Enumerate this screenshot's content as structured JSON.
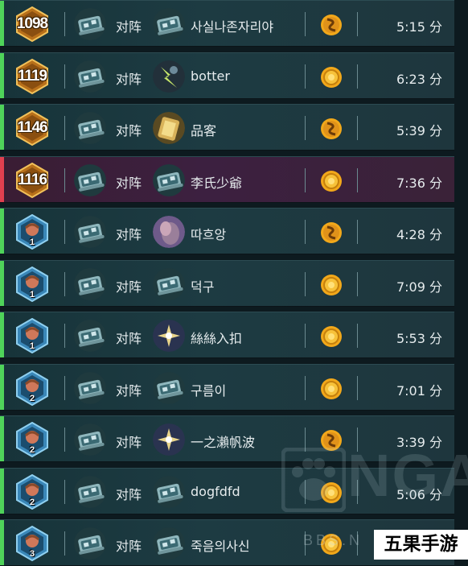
{
  "vs_label": "对阵",
  "colors": {
    "win_bar": "#4fd35a",
    "loss_bar": "#e0404f",
    "gold": "#f2a81a",
    "text": "#e6ecee"
  },
  "matches": [
    {
      "rank_type": "gold",
      "rank": "1098",
      "opponent": "사실나존자리야",
      "hero_icon": "mech-card-icon",
      "coin": "coin-swirl-icon",
      "duration": "5:15 分",
      "result": "win"
    },
    {
      "rank_type": "gold",
      "rank": "1119",
      "opponent": "botter",
      "hero_icon": "lightning-hero-icon",
      "coin": "coin-icon",
      "duration": "6:23 分",
      "result": "win"
    },
    {
      "rank_type": "gold",
      "rank": "1146",
      "opponent": "品客",
      "hero_icon": "golden-hero-icon",
      "coin": "coin-swirl-icon",
      "duration": "5:39 分",
      "result": "win"
    },
    {
      "rank_type": "gold",
      "rank": "1116",
      "opponent": "李氏少爺",
      "hero_icon": "mech-card-icon",
      "coin": "coin-icon",
      "duration": "7:36 分",
      "result": "loss"
    },
    {
      "rank_type": "tier",
      "rank": "1",
      "opponent": "따흐앙",
      "hero_icon": "purple-hero-icon",
      "coin": "coin-swirl-icon",
      "duration": "4:28 分",
      "result": "win"
    },
    {
      "rank_type": "tier",
      "rank": "1",
      "opponent": "덕구",
      "hero_icon": "mech-card-icon",
      "coin": "coin-icon",
      "duration": "7:09 分",
      "result": "win"
    },
    {
      "rank_type": "tier",
      "rank": "1",
      "opponent": "絲絲入扣",
      "hero_icon": "star-hero-icon",
      "coin": "coin-icon",
      "duration": "5:53 分",
      "result": "win"
    },
    {
      "rank_type": "tier",
      "rank": "2",
      "opponent": "구름이",
      "hero_icon": "mech-card-icon",
      "coin": "coin-icon",
      "duration": "7:01 分",
      "result": "win"
    },
    {
      "rank_type": "tier",
      "rank": "2",
      "opponent": "一之瀨帆波",
      "hero_icon": "star-hero-icon",
      "coin": "coin-swirl-icon",
      "duration": "3:39 分",
      "result": "win"
    },
    {
      "rank_type": "tier",
      "rank": "2",
      "opponent": "dogfdfd",
      "hero_icon": "mech-card-icon",
      "coin": "coin-icon",
      "duration": "5:06 分",
      "result": "win"
    },
    {
      "rank_type": "tier",
      "rank": "3",
      "opponent": "죽음의사신",
      "hero_icon": "mech-card-icon",
      "coin": "coin-icon",
      "duration": "",
      "result": "win"
    }
  ],
  "watermark": {
    "text": "NGA",
    "bbs": "BBS.N"
  },
  "site_logo": "五果手游"
}
